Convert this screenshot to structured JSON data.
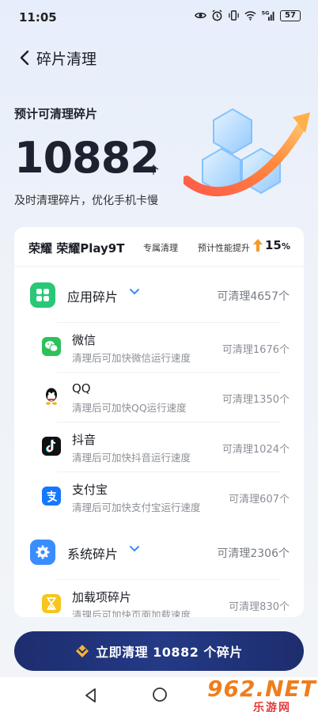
{
  "status_bar": {
    "time": "11:05",
    "signal_label": "5G",
    "battery": "57"
  },
  "header": {
    "title": "碎片清理"
  },
  "hero": {
    "label": "预计可清理碎片",
    "count": "10882",
    "unit": "个",
    "subtitle": "及时清理碎片，优化手机卡慢"
  },
  "card": {
    "device_name": "荣耀 荣耀Play9T",
    "device_tag": "专属清理",
    "boost_label": "预计性能提升",
    "boost_value": "15",
    "boost_unit": "%",
    "groups": [
      {
        "title": "应用碎片",
        "amount": "可清理4657个",
        "icon": "app-grid-icon",
        "color": "#28c876",
        "items": [
          {
            "name": "微信",
            "desc": "清理后可加快微信运行速度",
            "amount": "可清理1676个",
            "icon": "wechat-icon",
            "color": "#2dc15a"
          },
          {
            "name": "QQ",
            "desc": "清理后可加快QQ运行速度",
            "amount": "可清理1350个",
            "icon": "qq-icon",
            "color": "#1a1a1a"
          },
          {
            "name": "抖音",
            "desc": "清理后可加快抖音运行速度",
            "amount": "可清理1024个",
            "icon": "douyin-icon",
            "color": "#111111"
          },
          {
            "name": "支付宝",
            "desc": "清理后可加快支付宝运行速度",
            "amount": "可清理607个",
            "icon": "alipay-icon",
            "color": "#1677ff"
          }
        ]
      },
      {
        "title": "系统碎片",
        "amount": "可清理2306个",
        "icon": "gear-icon",
        "color": "#3a8dff",
        "items": [
          {
            "name": "加载项碎片",
            "desc": "清理后可加快页面加载速度",
            "amount": "可清理830个",
            "icon": "hourglass-icon",
            "color": "#f7c51e"
          }
        ]
      }
    ]
  },
  "clean_button": {
    "label": "立即清理 10882 个碎片"
  },
  "watermark": {
    "brand": "962.NET",
    "sub": "乐游网"
  },
  "colors": {
    "primary_button": "#1d2d6e",
    "accent_arrow": "#f59a2b",
    "chevron": "#3d8bff"
  }
}
